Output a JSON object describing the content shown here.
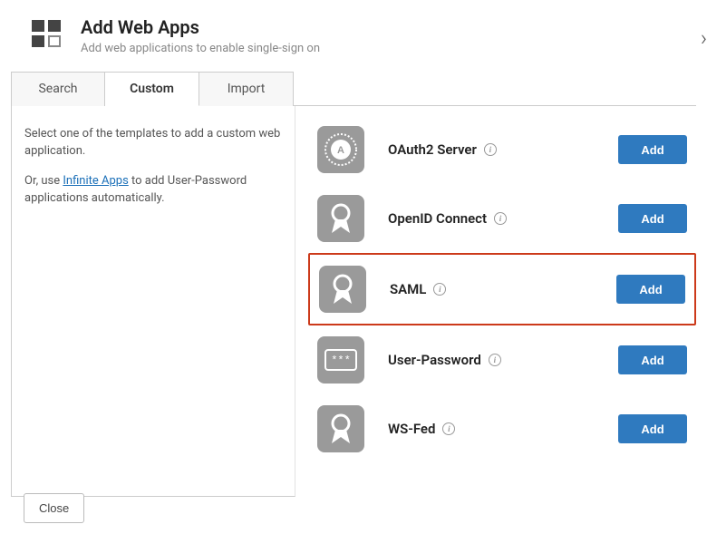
{
  "header": {
    "title": "Add Web Apps",
    "subtitle": "Add web applications to enable single-sign on"
  },
  "tabs": {
    "search": "Search",
    "custom": "Custom",
    "import": "Import"
  },
  "side": {
    "p1": "Select one of the templates to add a custom web application.",
    "p2_pre": "Or, use ",
    "p2_link": "Infinite Apps",
    "p2_post": " to add User-Password applications automatically."
  },
  "apps": {
    "oauth2": {
      "label": "OAuth2 Server",
      "add": "Add"
    },
    "openid": {
      "label": "OpenID Connect",
      "add": "Add"
    },
    "saml": {
      "label": "SAML",
      "add": "Add"
    },
    "userpw": {
      "label": "User-Password",
      "add": "Add"
    },
    "wsfed": {
      "label": "WS-Fed",
      "add": "Add"
    }
  },
  "footer": {
    "close": "Close"
  }
}
